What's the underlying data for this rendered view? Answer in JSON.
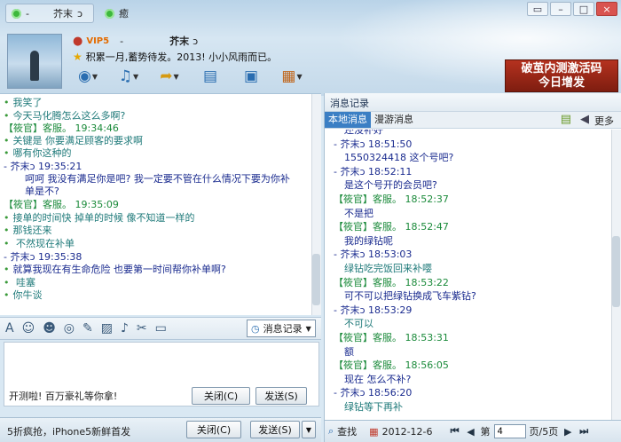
{
  "header": {
    "status_dash": "-",
    "nickname": "芥末",
    "nick_suffix": "ↄ",
    "mood_status": "癒",
    "vip_label": "VIP5",
    "profile_dash": "-",
    "signature": "积累一月,蓄势待发。2013!  小小风雨而已。",
    "window_buttons": [
      "▭",
      "–",
      "□",
      "×"
    ]
  },
  "ad": {
    "line1": "破茧内测激活码",
    "line2": "今日增发"
  },
  "chat": {
    "lines": [
      {
        "text": "我笑了",
        "kind": "msg",
        "prefix": "•"
      },
      {
        "text": "今天马化腾怎么这么多啊?",
        "kind": "msg",
        "prefix": "•"
      },
      {
        "text": "【筱官】客服。   19:34:46",
        "kind": "other"
      },
      {
        "text": "关键是   你要满足顾客的要求啊",
        "kind": "msg",
        "prefix": "•"
      },
      {
        "text": "哪有你这种的",
        "kind": "msg",
        "prefix": "•"
      },
      {
        "text": "-           芥末ↄ    19:35:21",
        "kind": "me"
      },
      {
        "text": "呵呵  我没有满足你是吧?  我一定要不管在什么情况下要为你补",
        "kind": "me",
        "indent": true
      },
      {
        "text": "单是不?",
        "kind": "me",
        "indent": true
      },
      {
        "text": "【筱官】客服。   19:35:09",
        "kind": "other"
      },
      {
        "text": "接单的时间快  掉单的时候  像不知道一样的",
        "kind": "msg",
        "prefix": "•"
      },
      {
        "text": "那钱还来",
        "kind": "msg",
        "prefix": "•"
      },
      {
        "text": "   不然现在补单",
        "kind": "msg",
        "prefix": "•"
      },
      {
        "text": "-           芥末ↄ    19:35:38",
        "kind": "me"
      },
      {
        "text": "就算我现在有生命危险  也要第一时间帮你补单啊?",
        "kind": "me",
        "prefix": "•"
      },
      {
        "text": "  哇塞",
        "kind": "msg",
        "prefix": "•"
      },
      {
        "text": "你牛谈",
        "kind": "msg",
        "prefix": "•"
      }
    ]
  },
  "toolbar": {
    "history_button": "消息记录"
  },
  "input": {
    "promo": "开测啦! 百万豪礼等你拿!",
    "close_label": "关闭(C)",
    "send_label": "发送(S)"
  },
  "bottom": {
    "promo": "5折疯抢，iPhone5新鲜首发",
    "close_label": "关闭(C)",
    "send_label": "发送(S)"
  },
  "history": {
    "title": "消息记录",
    "tab_local": "本地消息",
    "tab_roam": "漫游消息",
    "more": "更多",
    "lines": [
      {
        "text": "还没补好",
        "kind": "me",
        "x": 22
      },
      {
        "text": "-           芥末ↄ    18:51:50",
        "kind": "me",
        "x": 10
      },
      {
        "text": "1550324418  这个号吧?",
        "kind": "me",
        "x": 22
      },
      {
        "text": "-           芥末ↄ    18:52:11",
        "kind": "me",
        "x": 10
      },
      {
        "text": "是这个号开的会员吧?",
        "kind": "me",
        "x": 22
      },
      {
        "text": "【筱官】客服。   18:52:37",
        "kind": "other",
        "x": 10
      },
      {
        "text": "不是把",
        "kind": "me",
        "x": 22
      },
      {
        "text": "【筱官】客服。   18:52:47",
        "kind": "other",
        "x": 10
      },
      {
        "text": "我的绿钻呢",
        "kind": "me",
        "x": 22
      },
      {
        "text": "-           芥末ↄ    18:53:03",
        "kind": "me",
        "x": 10
      },
      {
        "text": "绿钻吃完饭回来补嘤",
        "kind": "msg",
        "x": 22
      },
      {
        "text": "【筱官】客服。   18:53:22",
        "kind": "other",
        "x": 10
      },
      {
        "text": "可不可以把绿钻换成飞车紫钻?",
        "kind": "me",
        "x": 22
      },
      {
        "text": "-           芥末ↄ    18:53:29",
        "kind": "me",
        "x": 10
      },
      {
        "text": "不可以",
        "kind": "msg",
        "x": 22
      },
      {
        "text": "【筱官】客服。   18:53:31",
        "kind": "other",
        "x": 10
      },
      {
        "text": "额",
        "kind": "me",
        "x": 22
      },
      {
        "text": "【筱官】客服。   18:56:05",
        "kind": "other",
        "x": 10
      },
      {
        "text": "现在  怎么不补?",
        "kind": "me",
        "x": 22
      },
      {
        "text": "-           芥末ↄ    18:56:20",
        "kind": "me",
        "x": 10
      },
      {
        "text": "绿钻等下再补",
        "kind": "msg",
        "x": 22
      }
    ],
    "footer": {
      "search": "查找",
      "date": "2012-12-6",
      "page_prefix": "第",
      "page_value": "4",
      "page_suffix": "页/5页"
    }
  }
}
